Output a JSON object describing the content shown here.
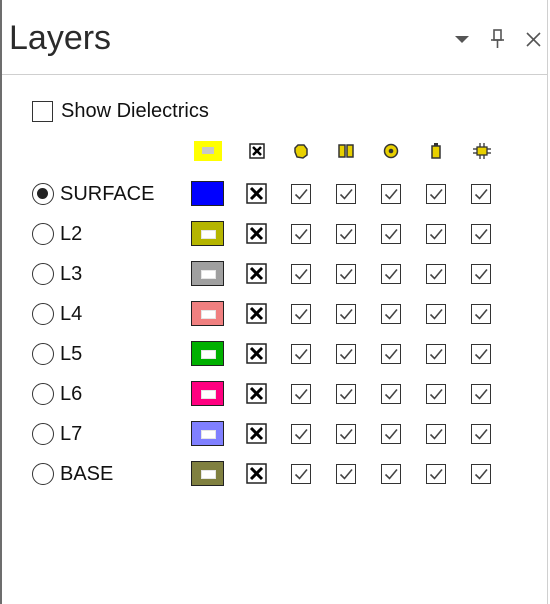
{
  "panel": {
    "title": "Layers",
    "header_icons": [
      "dropdown-arrow-icon",
      "pin-icon",
      "close-icon"
    ]
  },
  "show_dielectrics": {
    "label": "Show Dielectrics",
    "checked": false
  },
  "column_icons": [
    "color-column-icon",
    "visibility-column-icon",
    "pad-icon",
    "trace-icon",
    "via-icon",
    "copper-icon",
    "component-icon"
  ],
  "layers": [
    {
      "name": "SURFACE",
      "color": "#0000ff",
      "selected": true,
      "inner_visible": false
    },
    {
      "name": "L2",
      "color": "#b5b500",
      "selected": false,
      "inner_visible": true
    },
    {
      "name": "L3",
      "color": "#a0a0a0",
      "selected": false,
      "inner_visible": true
    },
    {
      "name": "L4",
      "color": "#f08080",
      "selected": false,
      "inner_visible": true
    },
    {
      "name": "L5",
      "color": "#00b000",
      "selected": false,
      "inner_visible": true
    },
    {
      "name": "L6",
      "color": "#ff0080",
      "selected": false,
      "inner_visible": true
    },
    {
      "name": "L7",
      "color": "#8080ff",
      "selected": false,
      "inner_visible": true
    },
    {
      "name": "BASE",
      "color": "#808040",
      "selected": false,
      "inner_visible": true
    }
  ]
}
